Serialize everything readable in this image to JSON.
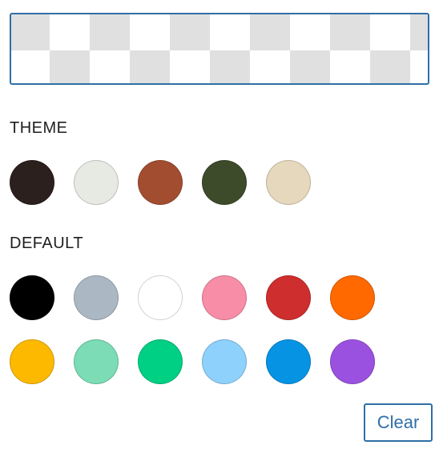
{
  "sections": {
    "theme": {
      "label": "THEME",
      "swatches": [
        {
          "name": "dark-brown",
          "color": "#2b201d"
        },
        {
          "name": "off-white",
          "color": "#e7e9e3"
        },
        {
          "name": "rust",
          "color": "#a34d30"
        },
        {
          "name": "dark-green",
          "color": "#3d4b2b"
        },
        {
          "name": "beige",
          "color": "#e6d8bc"
        }
      ]
    },
    "default": {
      "label": "DEFAULT",
      "swatches": [
        {
          "name": "black",
          "color": "#000000"
        },
        {
          "name": "cyan-bluish-gray",
          "color": "#abb8c3"
        },
        {
          "name": "white",
          "color": "#ffffff"
        },
        {
          "name": "pale-pink",
          "color": "#f78da7"
        },
        {
          "name": "vivid-red",
          "color": "#cf2e2e"
        },
        {
          "name": "luminous-vivid-orange",
          "color": "#ff6900"
        },
        {
          "name": "luminous-vivid-amber",
          "color": "#fcb900"
        },
        {
          "name": "light-green-cyan",
          "color": "#7bdcb5"
        },
        {
          "name": "vivid-green-cyan",
          "color": "#00d084"
        },
        {
          "name": "pale-cyan-blue",
          "color": "#8ed1fc"
        },
        {
          "name": "vivid-cyan-blue",
          "color": "#0693e3"
        },
        {
          "name": "vivid-purple",
          "color": "#9b51e0"
        }
      ]
    }
  },
  "actions": {
    "clear_label": "Clear"
  },
  "colors": {
    "accent": "#2f6fa6"
  }
}
